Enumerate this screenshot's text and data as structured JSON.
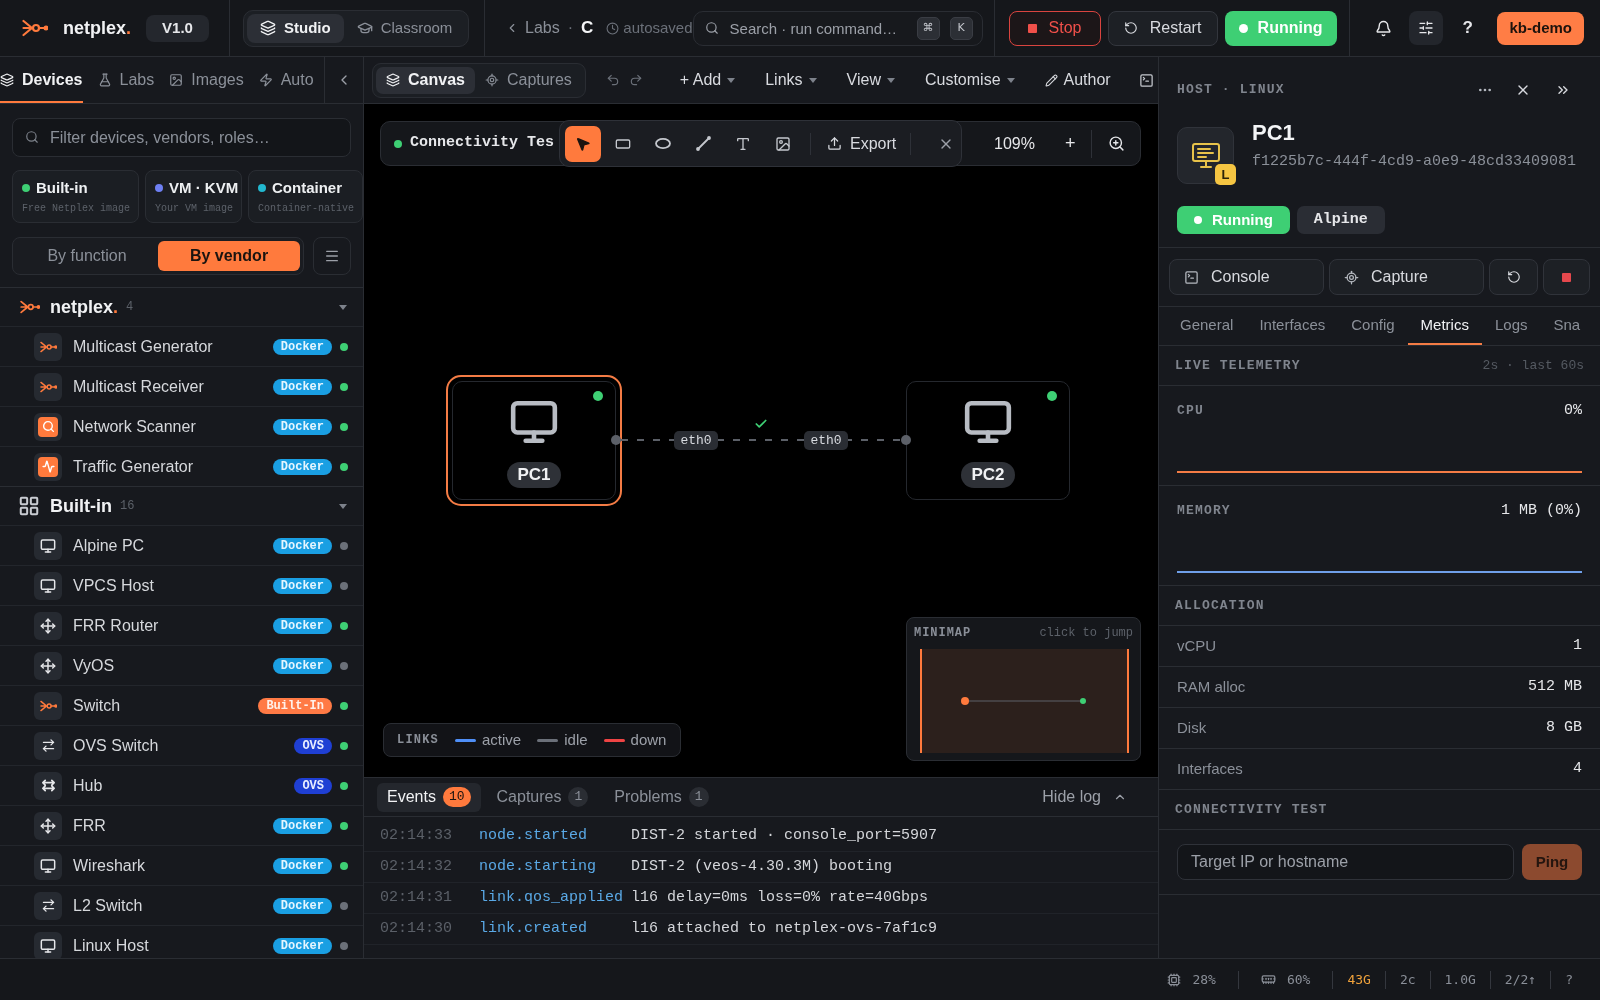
{
  "header": {
    "brand": {
      "name": "netplex",
      "mark": "."
    },
    "version": "V1.0",
    "modes": [
      {
        "label": "Studio",
        "selected": true
      },
      {
        "label": "Classroom",
        "selected": false
      }
    ],
    "breadcrumb": {
      "parent": "Labs",
      "separator": "·",
      "current": "C",
      "save_state": "autosaved"
    },
    "search": {
      "placeholder": "Search · run command…",
      "keys": [
        "⌘",
        "K"
      ]
    },
    "actions": [
      {
        "kind": "stop",
        "label": "Stop"
      },
      {
        "kind": "restart",
        "label": "Restart"
      },
      {
        "kind": "running",
        "label": "Running"
      }
    ],
    "help": "?",
    "user": "kb-demo"
  },
  "sidebar": {
    "tabs": [
      {
        "label": "Devices",
        "selected": true
      },
      {
        "label": "Labs",
        "selected": false
      },
      {
        "label": "Images",
        "selected": false
      },
      {
        "label": "Auto",
        "selected": false
      }
    ],
    "search": {
      "placeholder": "Filter devices, vendors, roles…"
    },
    "sources": [
      {
        "title": "Built-in",
        "subtitle": "Free Netplex image",
        "color": "#3ecf74"
      },
      {
        "title": "VM · KVM",
        "subtitle": "Your VM image",
        "color": "#6e7ff3"
      },
      {
        "title": "Container",
        "subtitle": "Container-native",
        "color": "#22b8cf"
      }
    ],
    "grouping": [
      {
        "label": "By function",
        "selected": false
      },
      {
        "label": "By vendor",
        "selected": true
      }
    ],
    "groups": [
      {
        "kind": "vendor",
        "name": "netplex",
        "mark": ".",
        "count": "4",
        "expanded": true,
        "children": [
          {
            "name": "Multicast Generator",
            "kind": "netplex",
            "badge": {
              "label": "Docker",
              "kind": "docker"
            },
            "color": "#3ecf74"
          },
          {
            "name": "Multicast Receiver",
            "kind": "netplex",
            "badge": {
              "label": "Docker",
              "kind": "docker"
            },
            "color": "#3ecf74"
          },
          {
            "name": "Network Scanner",
            "kind": "scanner",
            "badge": {
              "label": "Docker",
              "kind": "docker"
            },
            "color": "#3ecf74"
          },
          {
            "name": "Traffic Generator",
            "kind": "traffic",
            "badge": {
              "label": "Docker",
              "kind": "docker"
            },
            "color": "#3ecf74"
          }
        ]
      },
      {
        "kind": "catalog",
        "name": "Built-in",
        "count": "16",
        "expanded": true,
        "children": [
          {
            "name": "Alpine PC",
            "kind": "host",
            "badge": {
              "label": "Docker",
              "kind": "docker"
            },
            "color": "#6b7079"
          },
          {
            "name": "VPCS Host",
            "kind": "host",
            "badge": {
              "label": "Docker",
              "kind": "docker"
            },
            "color": "#6b7079"
          },
          {
            "name": "FRR Router",
            "kind": "router",
            "badge": {
              "label": "Docker",
              "kind": "docker"
            },
            "color": "#3ecf74"
          },
          {
            "name": "VyOS",
            "kind": "router",
            "badge": {
              "label": "Docker",
              "kind": "docker"
            },
            "color": "#6b7079"
          },
          {
            "name": "Switch",
            "kind": "netplex",
            "badge": {
              "label": "Built-In",
              "kind": "builtin"
            },
            "color": "#3ecf74"
          },
          {
            "name": "OVS Switch",
            "kind": "switch",
            "badge": {
              "label": "OVS",
              "kind": "ovs"
            },
            "color": "#3ecf74"
          },
          {
            "name": "Hub",
            "kind": "hub",
            "badge": {
              "label": "OVS",
              "kind": "ovs"
            },
            "color": "#3ecf74"
          },
          {
            "name": "FRR",
            "kind": "router",
            "badge": {
              "label": "Docker",
              "kind": "docker"
            },
            "color": "#3ecf74"
          },
          {
            "name": "Wireshark",
            "kind": "host",
            "badge": {
              "label": "Docker",
              "kind": "docker"
            },
            "color": "#3ecf74"
          },
          {
            "name": "L2 Switch",
            "kind": "switch",
            "badge": {
              "label": "Docker",
              "kind": "docker"
            },
            "color": "#6b7079"
          },
          {
            "name": "Linux Host",
            "kind": "host",
            "badge": {
              "label": "Docker",
              "kind": "docker"
            },
            "color": "#6b7079"
          }
        ]
      }
    ]
  },
  "canvas": {
    "views": [
      {
        "label": "Canvas",
        "selected": true
      },
      {
        "label": "Captures",
        "selected": false
      }
    ],
    "menus": [
      {
        "kind": "menu",
        "label": "+ Add"
      },
      {
        "kind": "menu",
        "label": "Links"
      },
      {
        "kind": "menu",
        "label": "View"
      },
      {
        "kind": "menu",
        "label": "Customise"
      },
      {
        "kind": "mode",
        "label": "Author"
      }
    ],
    "title": {
      "text": "Connectivity Tes",
      "running": true
    },
    "tools": [
      {
        "kind": "pointer",
        "selected": true
      },
      {
        "kind": "rectangle",
        "selected": false
      },
      {
        "kind": "ellipse",
        "selected": false
      },
      {
        "kind": "line",
        "selected": false
      },
      {
        "kind": "text",
        "selected": false
      },
      {
        "kind": "image",
        "selected": false
      }
    ],
    "export": "Export",
    "zoom": {
      "value": "109%",
      "step": "+"
    },
    "nodes": [
      {
        "label": "PC1",
        "selected": true,
        "running": true
      },
      {
        "label": "PC2",
        "selected": false,
        "running": true
      }
    ],
    "links": [
      {
        "kind": "idle",
        "from_port": "eth0",
        "to_port": "eth0",
        "verified": true
      }
    ],
    "legend": {
      "title": "LINKS",
      "items": [
        {
          "label": "active",
          "color": "#4f8ff7"
        },
        {
          "label": "idle",
          "color": "#6b7079"
        },
        {
          "label": "down",
          "color": "#ef4444"
        }
      ]
    },
    "minimap": {
      "title": "MINIMAP",
      "hint": "click to jump"
    }
  },
  "log": {
    "tabs": [
      {
        "label": "Events",
        "count": "10",
        "selected": true
      },
      {
        "label": "Captures",
        "count": "1",
        "selected": false
      },
      {
        "label": "Problems",
        "count": "1",
        "selected": false
      }
    ],
    "toggle": "Hide log",
    "events": [
      {
        "time": "02:14:33",
        "event": "node.started",
        "message": "DIST-2 started · console_port=5907"
      },
      {
        "time": "02:14:32",
        "event": "node.starting",
        "message": "DIST-2 (veos-4.30.3M) booting"
      },
      {
        "time": "02:14:31",
        "event": "link.qos_applied",
        "message": "l16 delay=0ms loss=0% rate=40Gbps"
      },
      {
        "time": "02:14:30",
        "event": "link.created",
        "message": "l16 attached to netplex-ovs-7af1c9"
      }
    ]
  },
  "inspector": {
    "category": "HOST · LINUX",
    "device": {
      "name": "PC1",
      "id": "f1225b7c-444f-4cd9-a0e9-48cd33409081",
      "type_badge": "L",
      "status": "Running",
      "image": "Alpine"
    },
    "actions": [
      {
        "label": "Console"
      },
      {
        "label": "Capture"
      }
    ],
    "tabs": [
      {
        "label": "General",
        "selected": false
      },
      {
        "label": "Interfaces",
        "selected": false
      },
      {
        "label": "Config",
        "selected": false
      },
      {
        "label": "Metrics",
        "selected": true
      },
      {
        "label": "Logs",
        "selected": false
      },
      {
        "label": "Sna",
        "selected": false
      }
    ],
    "telemetry": {
      "title": "LIVE TELEMETRY",
      "hint": "2s · last 60s",
      "metrics": [
        {
          "label": "CPU",
          "value": "0%",
          "color": "#f47c45"
        },
        {
          "label": "MEMORY",
          "value": "1 MB (0%)",
          "color": "#6f9fe8"
        }
      ]
    },
    "allocation": {
      "title": "ALLOCATION",
      "rows": [
        {
          "label": "vCPU",
          "value": "1"
        },
        {
          "label": "RAM alloc",
          "value": "512 MB"
        },
        {
          "label": "Disk",
          "value": "8 GB"
        },
        {
          "label": "Interfaces",
          "value": "4"
        }
      ]
    },
    "connectivity": {
      "title": "CONNECTIVITY TEST",
      "placeholder": "Target IP or hostname",
      "action": "Ping"
    }
  },
  "status_bar": [
    {
      "kind": "cpu",
      "value": "28%"
    },
    {
      "kind": "memory",
      "value": "60%"
    },
    {
      "kind": "warning",
      "value": "43G"
    },
    {
      "kind": "plain",
      "value": "2c"
    },
    {
      "kind": "plain",
      "value": "1.0G"
    },
    {
      "kind": "plain",
      "value": "2/2↑"
    },
    {
      "kind": "plain",
      "value": "?"
    }
  ]
}
